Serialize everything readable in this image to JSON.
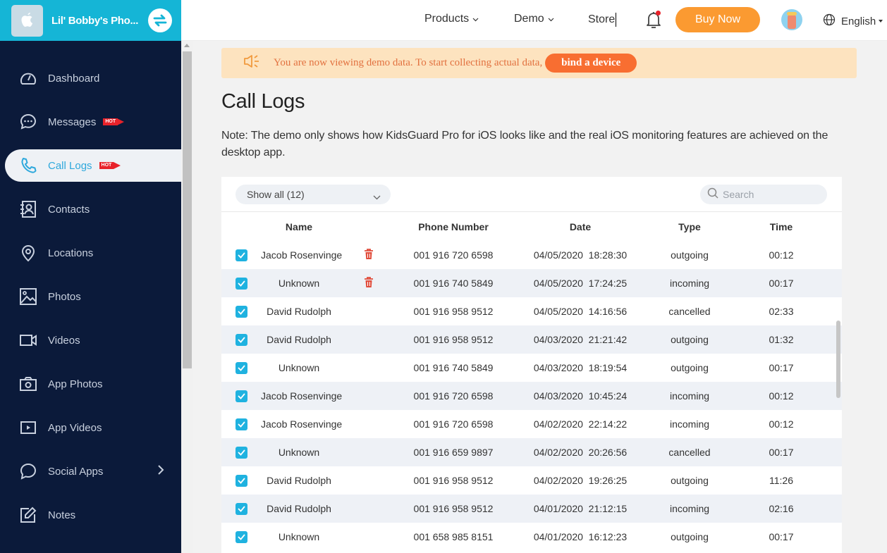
{
  "brand": {
    "device_name": "Lil' Bobby's Pho...",
    "logo_icon": "apple-icon",
    "switch_icon": "switch-device-icon"
  },
  "sidebar": {
    "items": [
      {
        "label": "Dashboard",
        "icon": "dashboard-icon",
        "hot": false,
        "active": false
      },
      {
        "label": "Messages",
        "icon": "messages-icon",
        "hot": true,
        "active": false
      },
      {
        "label": "Call Logs",
        "icon": "phone-icon",
        "hot": true,
        "active": true
      },
      {
        "label": "Contacts",
        "icon": "contacts-icon",
        "hot": false,
        "active": false
      },
      {
        "label": "Locations",
        "icon": "location-pin-icon",
        "hot": false,
        "active": false
      },
      {
        "label": "Photos",
        "icon": "photos-icon",
        "hot": false,
        "active": false
      },
      {
        "label": "Videos",
        "icon": "video-camera-icon",
        "hot": false,
        "active": false
      },
      {
        "label": "App Photos",
        "icon": "camera-icon",
        "hot": false,
        "active": false
      },
      {
        "label": "App Videos",
        "icon": "play-icon",
        "hot": false,
        "active": false
      },
      {
        "label": "Social Apps",
        "icon": "chat-bubble-icon",
        "hot": false,
        "active": false,
        "has_submenu": true
      },
      {
        "label": "Notes",
        "icon": "notes-icon",
        "hot": false,
        "active": false
      }
    ],
    "hot_badge": "HOT"
  },
  "topbar": {
    "products": "Products",
    "demo": "Demo",
    "store": "Store",
    "buy_now": "Buy Now",
    "language": "English"
  },
  "notice": {
    "text": "You are now viewing demo data. To start collecting actual data,",
    "button": "bind a device"
  },
  "page": {
    "title": "Call Logs",
    "note": "Note: The demo only shows how KidsGuard Pro for iOS looks like and the real iOS monitoring features are achieved on the desktop app."
  },
  "toolbar": {
    "filter_value": "Show all (12)",
    "search_placeholder": "Search"
  },
  "table": {
    "columns": [
      "Name",
      "Phone Number",
      "Date",
      "Type",
      "Time"
    ],
    "rows": [
      {
        "checked": true,
        "name": "Jacob Rosenvinge",
        "delete": true,
        "phone": "001 916 720 6598",
        "date": "04/05/2020  18:28:30",
        "type": "outgoing",
        "time": "00:12"
      },
      {
        "checked": true,
        "name": "Unknown",
        "delete": true,
        "phone": "001 916 740 5849",
        "date": "04/05/2020  17:24:25",
        "type": "incoming",
        "time": "00:17"
      },
      {
        "checked": true,
        "name": "David Rudolph",
        "delete": false,
        "phone": "001 916 958 9512",
        "date": "04/05/2020  14:16:56",
        "type": "cancelled",
        "time": "02:33"
      },
      {
        "checked": true,
        "name": "David Rudolph",
        "delete": false,
        "phone": "001 916 958 9512",
        "date": "04/03/2020  21:21:42",
        "type": "outgoing",
        "time": "01:32"
      },
      {
        "checked": true,
        "name": "Unknown",
        "delete": false,
        "phone": "001 916 740 5849",
        "date": "04/03/2020  18:19:54",
        "type": "outgoing",
        "time": "00:17"
      },
      {
        "checked": true,
        "name": "Jacob Rosenvinge",
        "delete": false,
        "phone": "001 916 720 6598",
        "date": "04/03/2020  10:45:24",
        "type": "incoming",
        "time": "00:12"
      },
      {
        "checked": true,
        "name": "Jacob Rosenvinge",
        "delete": false,
        "phone": "001 916 720 6598",
        "date": "04/02/2020  22:14:22",
        "type": "incoming",
        "time": "00:12"
      },
      {
        "checked": true,
        "name": "Unknown",
        "delete": false,
        "phone": "001 916 659 9897",
        "date": "04/02/2020  20:26:56",
        "type": "cancelled",
        "time": "00:17"
      },
      {
        "checked": true,
        "name": "David Rudolph",
        "delete": false,
        "phone": "001 916 958 9512",
        "date": "04/02/2020  19:26:25",
        "type": "outgoing",
        "time": "11:26"
      },
      {
        "checked": true,
        "name": "David Rudolph",
        "delete": false,
        "phone": "001 916 958 9512",
        "date": "04/01/2020  21:12:15",
        "type": "incoming",
        "time": "02:16"
      },
      {
        "checked": true,
        "name": "Unknown",
        "delete": false,
        "phone": "001 658 985 8151",
        "date": "04/01/2020  16:12:23",
        "type": "outgoing",
        "time": "00:17"
      }
    ]
  },
  "colors": {
    "brand_header": "#15b5d6",
    "sidebar_bg": "#0b1a3a",
    "active_text": "#2ea8dc",
    "buy_button": "#fb9a31",
    "notice_bg": "#fde3bf",
    "bind_button": "#f86e31",
    "checkbox": "#1fb2e0",
    "delete_icon": "#e04b3a",
    "hot_badge": "#e8222a"
  }
}
